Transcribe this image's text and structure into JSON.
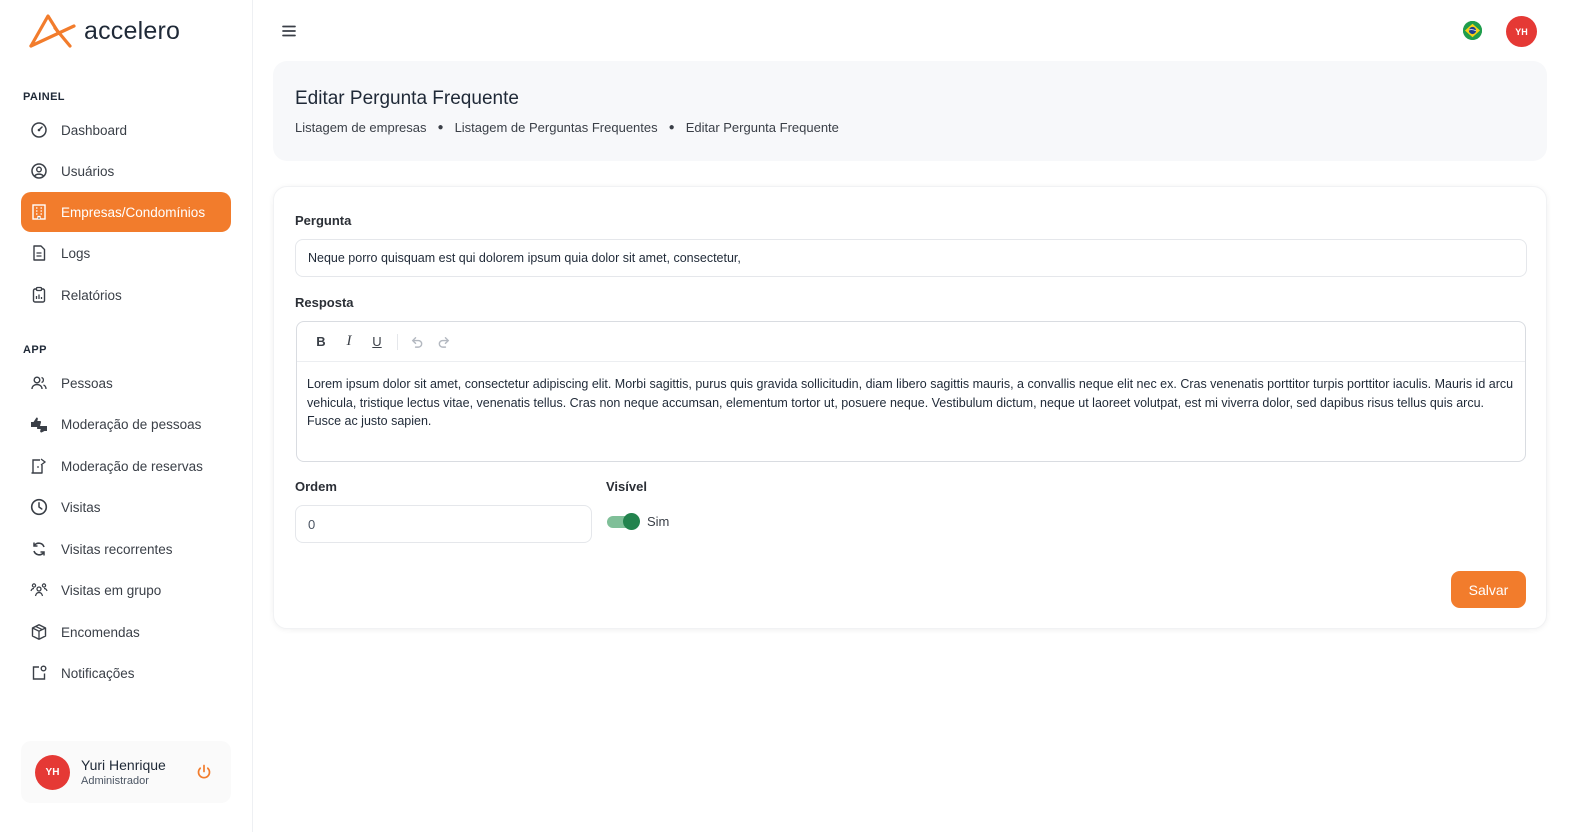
{
  "brand": {
    "name": "accelero",
    "accent": "#f27c2c"
  },
  "sidebar": {
    "sections": [
      {
        "title": "PAINEL"
      },
      {
        "title": "APP"
      }
    ],
    "items": [
      {
        "label": "Dashboard",
        "icon": "dashboard-gauge-icon",
        "active": false
      },
      {
        "label": "Usuários",
        "icon": "user-circle-icon",
        "active": false
      },
      {
        "label": "Empresas/Condomínios",
        "icon": "building-icon",
        "active": true
      },
      {
        "label": "Logs",
        "icon": "document-icon",
        "active": false
      },
      {
        "label": "Relatórios",
        "icon": "clipboard-icon",
        "active": false
      },
      {
        "label": "Pessoas",
        "icon": "people-icon",
        "active": false
      },
      {
        "label": "Moderação de pessoas",
        "icon": "thumbs-icon",
        "active": false
      },
      {
        "label": "Moderação de reservas",
        "icon": "door-icon",
        "active": false
      },
      {
        "label": "Visitas",
        "icon": "clock-icon",
        "active": false
      },
      {
        "label": "Visitas recorrentes",
        "icon": "refresh-icon",
        "active": false
      },
      {
        "label": "Visitas em grupo",
        "icon": "group-icon",
        "active": false
      },
      {
        "label": "Encomendas",
        "icon": "package-icon",
        "active": false
      },
      {
        "label": "Notificações",
        "icon": "notification-icon",
        "active": false
      }
    ]
  },
  "user": {
    "initials": "YH",
    "name": "Yuri Henrique",
    "role": "Administrador"
  },
  "topbar": {
    "avatar_initials": "YH",
    "language_flag": "brazil-flag-icon"
  },
  "header": {
    "title": "Editar Pergunta Frequente",
    "breadcrumb": [
      "Listagem de empresas",
      "Listagem de Perguntas Frequentes",
      "Editar Pergunta Frequente"
    ]
  },
  "form": {
    "question_label": "Pergunta",
    "question_value": "Neque porro quisquam est qui dolorem ipsum quia dolor sit amet, consectetur,",
    "answer_label": "Resposta",
    "answer_toolbar": {
      "bold": "B",
      "italic": "I",
      "underline": "U"
    },
    "answer_value": "Lorem ipsum dolor sit amet, consectetur adipiscing elit. Morbi sagittis, purus quis gravida sollicitudin, diam libero sagittis mauris, a convallis neque elit nec ex. Cras venenatis porttitor turpis porttitor iaculis. Mauris id arcu vehicula, tristique lectus vitae, venenatis tellus. Cras non neque accumsan, elementum tortor ut, posuere neque. Vestibulum dictum, neque ut laoreet volutpat, est mi viverra dolor, sed dapibus risus tellus quis arcu. Fusce ac justo sapien.",
    "order_label": "Ordem",
    "order_value": "0",
    "visible_label": "Visível",
    "visible_value": true,
    "visible_text": "Sim",
    "save_label": "Salvar"
  }
}
